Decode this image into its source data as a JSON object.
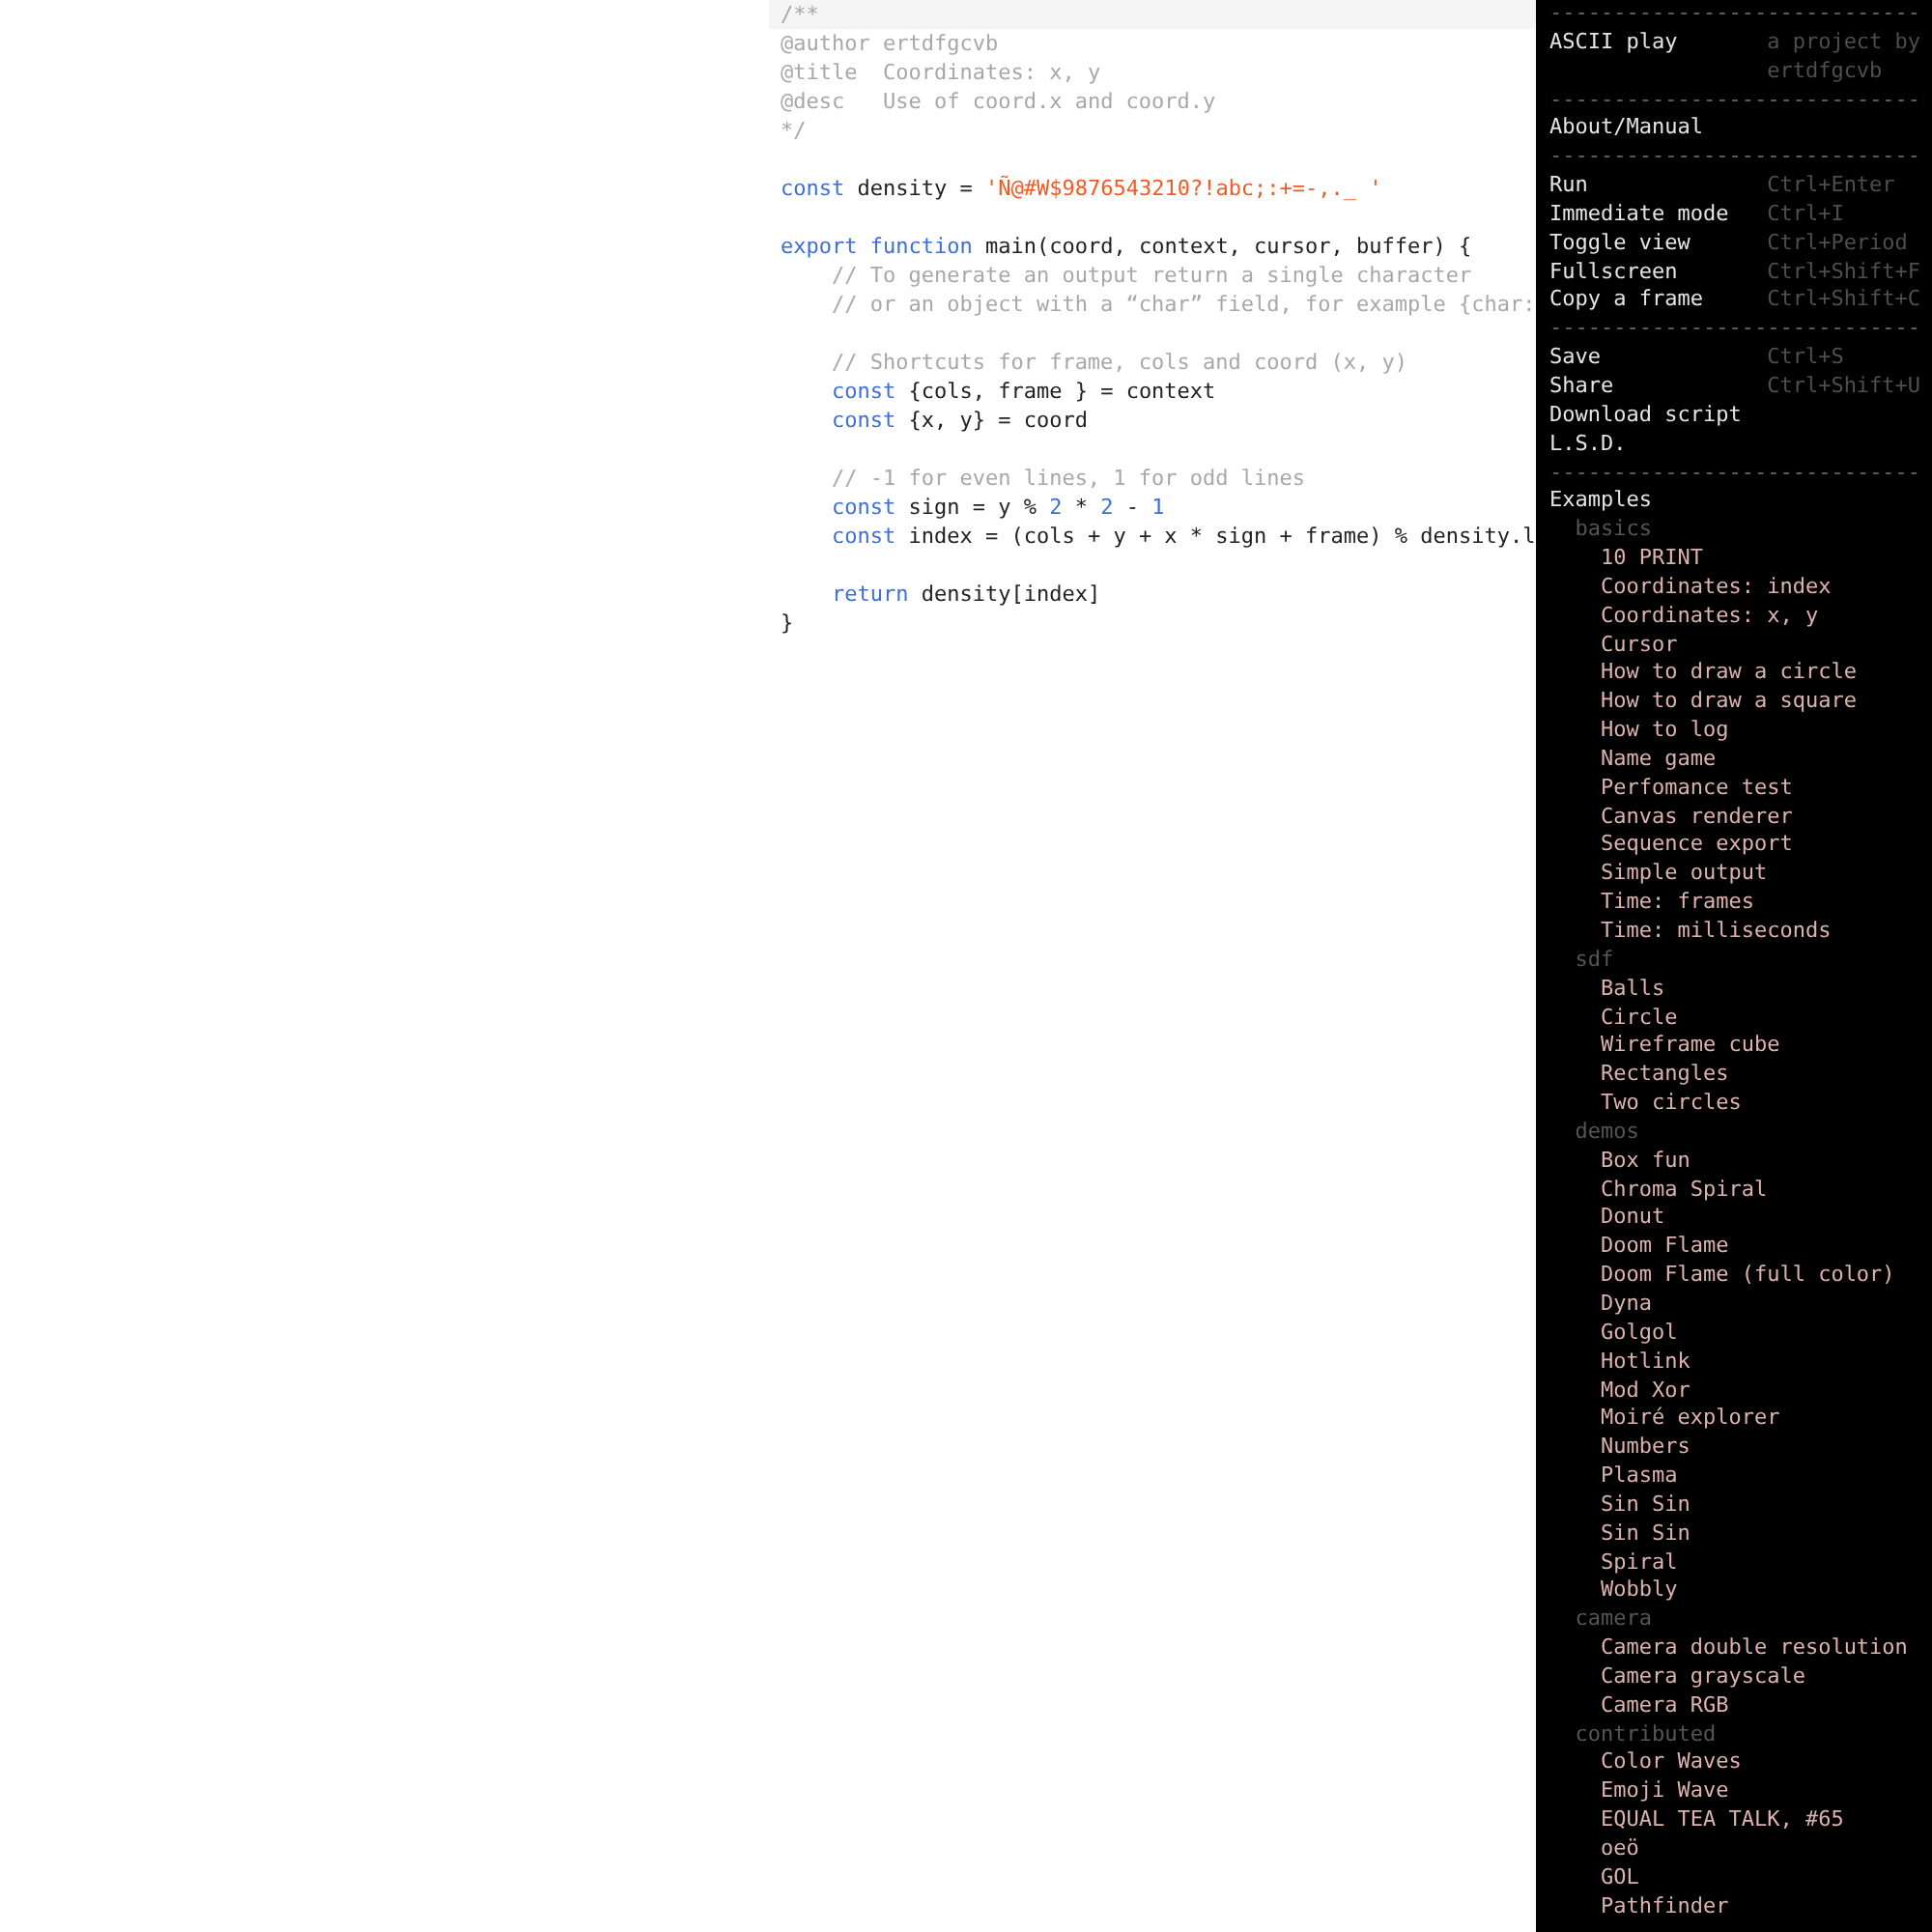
{
  "editor": {
    "lines": [
      {
        "kind": "code",
        "tokens": [
          {
            "kind": "comment",
            "text": "/**"
          }
        ]
      },
      {
        "kind": "code",
        "tokens": [
          {
            "kind": "comment",
            "text": "@author ertdfgcvb"
          }
        ]
      },
      {
        "kind": "code",
        "tokens": [
          {
            "kind": "comment",
            "text": "@title  Coordinates: x, y"
          }
        ]
      },
      {
        "kind": "code",
        "tokens": [
          {
            "kind": "comment",
            "text": "@desc   Use of coord.x and coord.y"
          }
        ]
      },
      {
        "kind": "code",
        "tokens": [
          {
            "kind": "comment",
            "text": "*/"
          }
        ]
      },
      {
        "kind": "blank"
      },
      {
        "kind": "code",
        "tokens": [
          {
            "kind": "keyword",
            "text": "const"
          },
          {
            "kind": "plain",
            "text": " density = "
          },
          {
            "kind": "string",
            "text": "'Ñ@#W$9876543210?!abc;:+=-,._ '"
          }
        ]
      },
      {
        "kind": "blank"
      },
      {
        "kind": "code",
        "tokens": [
          {
            "kind": "keyword",
            "text": "export"
          },
          {
            "kind": "keyword",
            "text": " function"
          },
          {
            "kind": "plain",
            "text": " main(coord, context, cursor, buffer) {"
          }
        ]
      },
      {
        "kind": "code",
        "indented": true,
        "tokens": [
          {
            "kind": "comment",
            "text": "// To generate an output return a single character"
          }
        ]
      },
      {
        "kind": "code",
        "indented": true,
        "tokens": [
          {
            "kind": "comment",
            "text": "// or an object with a “char” field, for example {char:"
          }
        ]
      },
      {
        "kind": "blank"
      },
      {
        "kind": "code",
        "indented": true,
        "tokens": [
          {
            "kind": "comment",
            "text": "// Shortcuts for frame, cols and coord (x, y)"
          }
        ]
      },
      {
        "kind": "code",
        "indented": true,
        "tokens": [
          {
            "kind": "keyword",
            "text": "const"
          },
          {
            "kind": "plain",
            "text": " {cols, frame } = context"
          }
        ]
      },
      {
        "kind": "code",
        "indented": true,
        "tokens": [
          {
            "kind": "keyword",
            "text": "const"
          },
          {
            "kind": "plain",
            "text": " {x, y} = coord"
          }
        ]
      },
      {
        "kind": "blank"
      },
      {
        "kind": "code",
        "indented": true,
        "tokens": [
          {
            "kind": "comment",
            "text": "// -1 for even lines, 1 for odd lines"
          }
        ]
      },
      {
        "kind": "code",
        "indented": true,
        "tokens": [
          {
            "kind": "keyword",
            "text": "const"
          },
          {
            "kind": "plain",
            "text": " sign = y % "
          },
          {
            "kind": "number",
            "text": "2"
          },
          {
            "kind": "plain",
            "text": " * "
          },
          {
            "kind": "number",
            "text": "2"
          },
          {
            "kind": "plain",
            "text": " - "
          },
          {
            "kind": "number",
            "text": "1"
          }
        ]
      },
      {
        "kind": "code",
        "indented": true,
        "tokens": [
          {
            "kind": "keyword",
            "text": "const"
          },
          {
            "kind": "plain",
            "text": " index = (cols + y + x * sign + frame) % density.l"
          }
        ]
      },
      {
        "kind": "blank"
      },
      {
        "kind": "code",
        "indented": true,
        "tokens": [
          {
            "kind": "keyword",
            "text": "return"
          },
          {
            "kind": "plain",
            "text": " density[index]"
          }
        ]
      },
      {
        "kind": "code",
        "tokens": [
          {
            "kind": "plain",
            "text": "}"
          }
        ]
      }
    ]
  },
  "sidebar": {
    "items": [
      {
        "kind": "separator",
        "text": "-----------------------------"
      },
      {
        "kind": "command",
        "label": "ASCII play",
        "shortcut": "a project by ertdfgcvb"
      },
      {
        "kind": "separator",
        "text": "-----------------------------"
      },
      {
        "kind": "command",
        "label": "About/Manual"
      },
      {
        "kind": "separator",
        "text": "-----------------------------"
      },
      {
        "kind": "command",
        "label": "Run",
        "shortcut": "Ctrl+Enter"
      },
      {
        "kind": "command",
        "label": "Immediate mode",
        "shortcut": "Ctrl+I"
      },
      {
        "kind": "command",
        "label": "Toggle view",
        "shortcut": "Ctrl+Period"
      },
      {
        "kind": "command",
        "label": "Fullscreen",
        "shortcut": "Ctrl+Shift+F"
      },
      {
        "kind": "command",
        "label": "Copy a frame",
        "shortcut": "Ctrl+Shift+C"
      },
      {
        "kind": "separator",
        "text": "-----------------------------"
      },
      {
        "kind": "command",
        "label": "Save",
        "shortcut": "Ctrl+S"
      },
      {
        "kind": "command",
        "label": "Share",
        "shortcut": "Ctrl+Shift+U"
      },
      {
        "kind": "command",
        "label": "Download script"
      },
      {
        "kind": "command",
        "label": "L.S.D."
      },
      {
        "kind": "separator",
        "text": "-----------------------------"
      },
      {
        "kind": "tree",
        "label": "Examples",
        "children": [
          {
            "label": "basics",
            "children": [
              {
                "label": "10 PRINT"
              },
              {
                "label": "Coordinates: index"
              },
              {
                "label": "Coordinates: x, y"
              },
              {
                "label": "Cursor"
              },
              {
                "label": "How to draw a circle"
              },
              {
                "label": "How to draw a square"
              },
              {
                "label": "How to log"
              },
              {
                "label": "Name game"
              },
              {
                "label": "Perfomance test"
              },
              {
                "label": "Canvas renderer"
              },
              {
                "label": "Sequence export"
              },
              {
                "label": "Simple output"
              },
              {
                "label": "Time: frames"
              },
              {
                "label": "Time: milliseconds"
              }
            ]
          },
          {
            "label": "sdf",
            "children": [
              {
                "label": "Balls"
              },
              {
                "label": "Circle"
              },
              {
                "label": "Wireframe cube"
              },
              {
                "label": "Rectangles"
              },
              {
                "label": "Two circles"
              }
            ]
          },
          {
            "label": "demos",
            "children": [
              {
                "label": "Box fun"
              },
              {
                "label": "Chroma Spiral"
              },
              {
                "label": "Donut"
              },
              {
                "label": "Doom Flame"
              },
              {
                "label": "Doom Flame (full color)"
              },
              {
                "label": "Dyna"
              },
              {
                "label": "Golgol"
              },
              {
                "label": "Hotlink"
              },
              {
                "label": "Mod Xor"
              },
              {
                "label": "Moiré explorer"
              },
              {
                "label": "Numbers"
              },
              {
                "label": "Plasma"
              },
              {
                "label": "Sin Sin"
              },
              {
                "label": "Sin Sin"
              },
              {
                "label": "Spiral"
              },
              {
                "label": "Wobbly"
              }
            ]
          },
          {
            "label": "camera",
            "children": [
              {
                "label": "Camera double resolution"
              },
              {
                "label": "Camera grayscale"
              },
              {
                "label": "Camera RGB"
              }
            ]
          },
          {
            "label": "contributed",
            "children": [
              {
                "label": "Color Waves"
              },
              {
                "label": "Emoji Wave"
              },
              {
                "label": "EQUAL TEA TALK, #65"
              },
              {
                "label": "oeö"
              },
              {
                "label": "GOL"
              },
              {
                "label": "Pathfinder"
              }
            ]
          }
        ]
      }
    ]
  }
}
